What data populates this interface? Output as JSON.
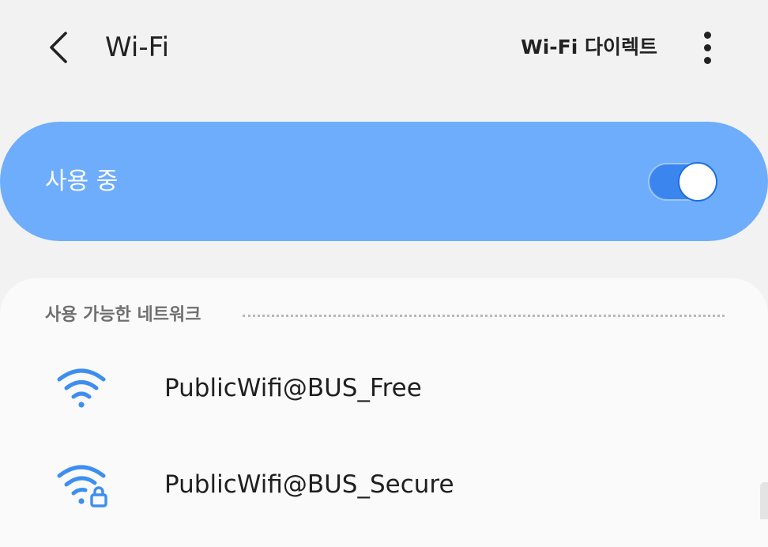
{
  "header": {
    "title": "Wi-Fi",
    "wifi_direct_label": "Wi-Fi 다이렉트"
  },
  "master_switch": {
    "label": "사용 중",
    "enabled": true
  },
  "networks_section": {
    "header": "사용 가능한 네트워크",
    "networks": [
      {
        "name": "PublicWifi@BUS_Free",
        "icon": "wifi-open-icon",
        "secured": false
      },
      {
        "name": "PublicWifi@BUS_Secure",
        "icon": "wifi-lock-icon",
        "secured": true
      }
    ]
  },
  "colors": {
    "background": "#f2f2f2",
    "accent": "#6eadfc",
    "toggle_on": "#3b86ee",
    "wifi_icon": "#3d8ef0"
  }
}
